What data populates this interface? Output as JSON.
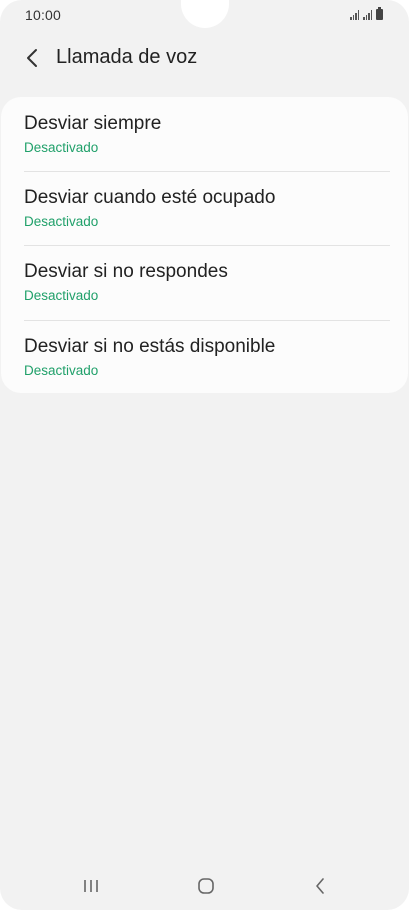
{
  "status_bar": {
    "time": "10:00"
  },
  "header": {
    "title": "Llamada de voz"
  },
  "settings": {
    "items": [
      {
        "label": "Desviar siempre",
        "status": "Desactivado"
      },
      {
        "label": "Desviar cuando esté ocupado",
        "status": "Desactivado"
      },
      {
        "label": "Desviar si no respondes",
        "status": "Desactivado"
      },
      {
        "label": "Desviar si no estás disponible",
        "status": "Desactivado"
      }
    ]
  },
  "icons": {
    "back": "back-arrow-icon",
    "nav_recent": "recent-apps-icon",
    "nav_home": "home-icon",
    "nav_back": "nav-back-icon"
  },
  "colors": {
    "background": "#f2f2f2",
    "card": "#fcfcfc",
    "status_text": "#20a06a",
    "primary_text": "#222222"
  }
}
